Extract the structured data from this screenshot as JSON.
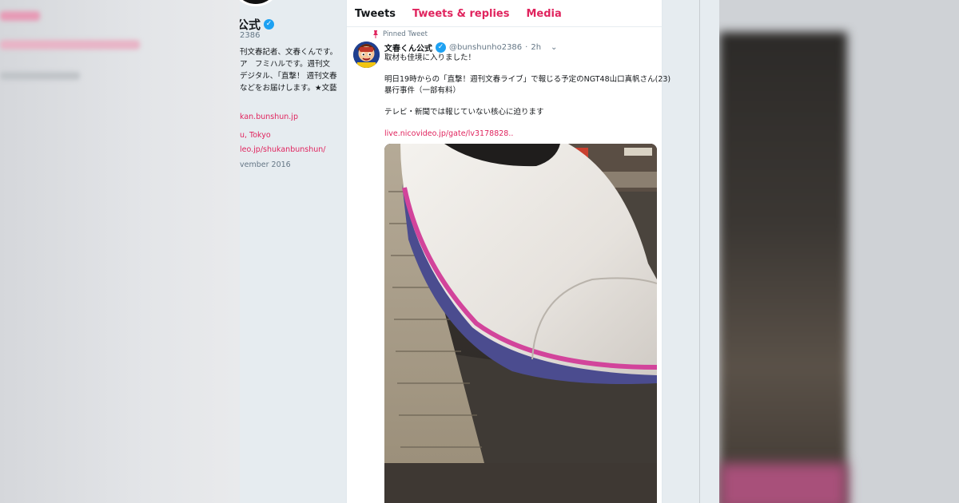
{
  "tabs": [
    {
      "label": "Tweets",
      "active": true
    },
    {
      "label": "Tweets & replies",
      "active": false
    },
    {
      "label": "Media",
      "active": false
    }
  ],
  "profile": {
    "name": "公式",
    "handle": "2386",
    "bio": [
      "刊文春記者、文春くんです。",
      "ア　フミハルです。週刊文",
      "デジタル、「直撃！ 週刊文春",
      "などをお届けします。★文藝"
    ],
    "website": "kan.bunshun.jp",
    "location": "u, Tokyo",
    "link2": "leo.jp/shukanbunshun/",
    "joined": "vember 2016"
  },
  "tweet": {
    "pinned_label": "Pinned Tweet",
    "author_name": "文春くん公式",
    "author_handle": "@bunshunho2386",
    "time": "2h",
    "line1": "取材も佳境に入りました！",
    "line2": "明日19時からの「直撃！週刊文春ライブ」で報じる予定のNGT48山口真帆さん(23)",
    "line3": "暴行事件（一部有料）",
    "line4": "テレビ・新聞では報じていない核心に迫ります",
    "link": "live.nicovideo.jp/gate/lv3178828..",
    "media_alt": "shinkansen-train-photo"
  },
  "colors": {
    "accent": "#e0245e",
    "verified": "#1da1f2",
    "page_bg": "#e6ecf0"
  },
  "icons": [
    "verified-badge-icon",
    "pin-icon",
    "chevron-down-icon"
  ]
}
